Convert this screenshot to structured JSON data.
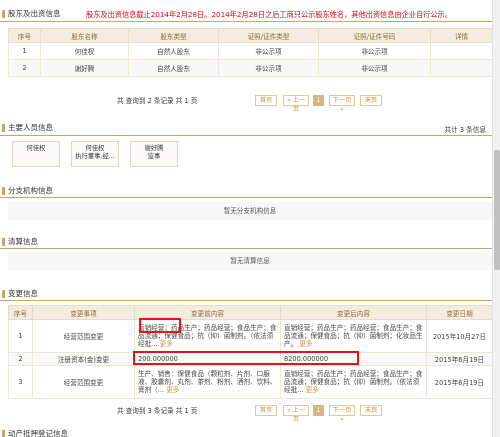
{
  "shareholders": {
    "title": "股东及出资信息",
    "notice": "股东及出资信息截止2014年2月28日。2014年2月28日之后工商只公示股东姓名，其他出资信息由企业自行公示。",
    "headers": [
      "序号",
      "股东名称",
      "股东类型",
      "证照/证件类型",
      "证照/证件号码",
      "详情"
    ],
    "rows": [
      [
        "1",
        "何佳权",
        "自然人股东",
        "非公示项",
        "非公示项",
        ""
      ],
      [
        "2",
        "谢好腾",
        "自然人股东",
        "非公示项",
        "非公示项",
        ""
      ]
    ],
    "pager": {
      "summary": "共 查询到 2 条记录 共 1 页",
      "first": "首页",
      "prev": "« 上一页",
      "current": "1",
      "next": "下一页 »",
      "last": "末页"
    }
  },
  "personnel": {
    "title": "主要人员信息",
    "count": "共计 3 条信息",
    "people": [
      {
        "name": "何佳权",
        "role": ""
      },
      {
        "name": "何佳权",
        "role": "执行董事,经..."
      },
      {
        "name": "谢好腾",
        "role": "监事"
      }
    ]
  },
  "branches": {
    "title": "分支机构信息",
    "empty": "暂无分支机构信息"
  },
  "liquidation": {
    "title": "清算信息",
    "empty": "暂无清算信息"
  },
  "changes": {
    "title": "变更信息",
    "headers": [
      "序号",
      "变更事项",
      "变更前内容",
      "变更后内容",
      "变更日期"
    ],
    "rows": [
      {
        "no": "1",
        "item": "经营范围变更",
        "before": "直销经营；药品生产；药品经营；食品生产；食品流通；保健食品；抗（抑）菌制剂。（依法须经批...",
        "before_more": "更多",
        "after": "直销经营；药品生产；药品经营；食品生产；食品流通；保健食品；抗（抑）菌制剂；化妆品生产。",
        "after_more": "更多",
        "date": "2015年10月27日"
      },
      {
        "no": "2",
        "item": "注册资本(金)变更",
        "before": "200.000000",
        "before_more": "",
        "after": "8200.000000",
        "after_more": "",
        "date": "2015年6月19日"
      },
      {
        "no": "3",
        "item": "经营范围变更",
        "before": "生产、销售：保健食品（颗粒剂、片剂、口服液、胶囊剂、丸剂、茶剂、粉剂、酒剂、饮料、膏剂（...",
        "before_more": "更多",
        "after": "直销经营；药品生产；药品经营；食品生产；食品流通；保健食品；抗（抑）菌制剂。（依法须经批...",
        "after_more": "更多",
        "date": "2015年6月19日"
      }
    ],
    "pager": {
      "summary": "共 查询到 3 条记录 共 1 页",
      "first": "首页",
      "prev": "« 上一页",
      "current": "1",
      "next": "下一页 »",
      "last": "末页"
    }
  },
  "next_section": {
    "title": "动产抵押登记信息"
  },
  "colors": {
    "accent": "#c8a46e",
    "notice": "#d9001b",
    "highlight_box": "#e0161f",
    "header_bg": "#f4ecde"
  }
}
